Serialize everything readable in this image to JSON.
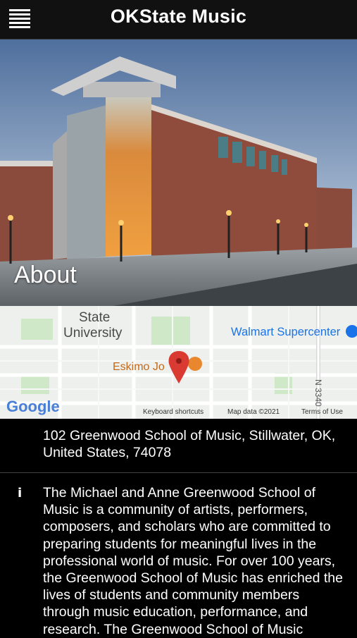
{
  "app": {
    "title": "OKState Music"
  },
  "hero": {
    "title": "About"
  },
  "map": {
    "labels": {
      "university_line1": "State",
      "university_line2": "University",
      "walmart": "Walmart Supercenter",
      "eskimo": "Eskimo Jo",
      "road": "N 3340",
      "google": "Google",
      "keyboard": "Keyboard shortcuts",
      "mapdata": "Map data ©2021",
      "terms": "Terms of Use"
    }
  },
  "address": "102 Greenwood School of Music, Stillwater, OK, United States, 74078",
  "description": "The Michael and Anne Greenwood School of Music is a community of artists, performers, composers, and scholars who are committed to preparing students for meaningful lives in the professional world of music. For over 100 years, the Greenwood School of Music has enriched the lives of students and community members through music education, performance, and research. The Greenwood School of Music",
  "icons": {
    "menu": "hamburger-menu-icon",
    "info": "info-icon",
    "map_pin": "map-pin-icon"
  },
  "colors": {
    "appbar": "#111111",
    "background": "#000000",
    "pin": "#d93a31",
    "eskimo": "#e8872e",
    "walmart": "#1a73e8"
  }
}
